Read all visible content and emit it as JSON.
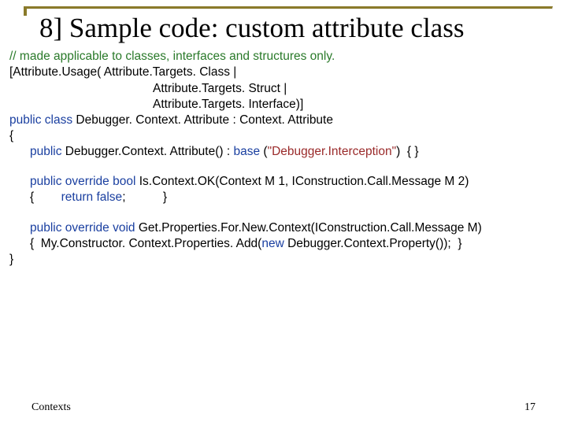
{
  "title": "8] Sample code: custom attribute class",
  "code": {
    "l1": "// made applicable to classes, interfaces and structures only.",
    "l2": "[Attribute.Usage( Attribute.Targets. Class |",
    "l3": "Attribute.Targets. Struct |",
    "l4": "Attribute.Targets. Interface)]",
    "l5a": "public class",
    "l5b": " Debugger. Context. Attribute : Context. Attribute",
    "l6": "{",
    "l7a": "public",
    "l7b": " Debugger.Context. Attribute() : ",
    "l7c": "base",
    "l7d": " (",
    "l7e": "\"Debugger.Interception\"",
    "l7f": ")  { }",
    "l8a": "public override bool",
    "l8b": " Is.Context.OK(Context M 1, IConstruction.Call.Message M 2)",
    "l9a": "{        ",
    "l9b": "return false",
    "l9c": ";           }",
    "l10a": "public override void",
    "l10b": " Get.Properties.For.New.Context(IConstruction.Call.Message M)",
    "l11a": "{  My.Constructor. Context.Properties. Add(",
    "l11b": "new",
    "l11c": " Debugger.Context.Property());  }",
    "l12": "}"
  },
  "footer": {
    "left": "Contexts",
    "right": "17"
  }
}
